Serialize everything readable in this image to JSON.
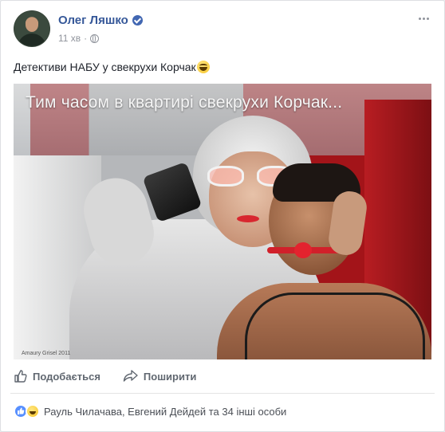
{
  "post": {
    "author": "Олег Ляшко",
    "time": "11 хв",
    "separator": "·",
    "text": "Детективи НАБУ у свекрухи Корчак",
    "text_emoji_icon": "laughing-emoji-icon"
  },
  "image": {
    "caption": "Тим часом в квартирі свекрухи Корчак...",
    "watermark": "Amaury Grisel 2011"
  },
  "actions": {
    "like": "Подобається",
    "share": "Поширити"
  },
  "reactions": {
    "icons": [
      "like-reaction-icon",
      "haha-reaction-icon"
    ],
    "summary": "Рауль Чилачава, Евгений Дейдей та 34 інші особи"
  },
  "colors": {
    "link": "#365899",
    "verified": "#4267b2",
    "muted": "#90949c",
    "action_text": "#606770",
    "like_reaction": "#5890ff"
  }
}
